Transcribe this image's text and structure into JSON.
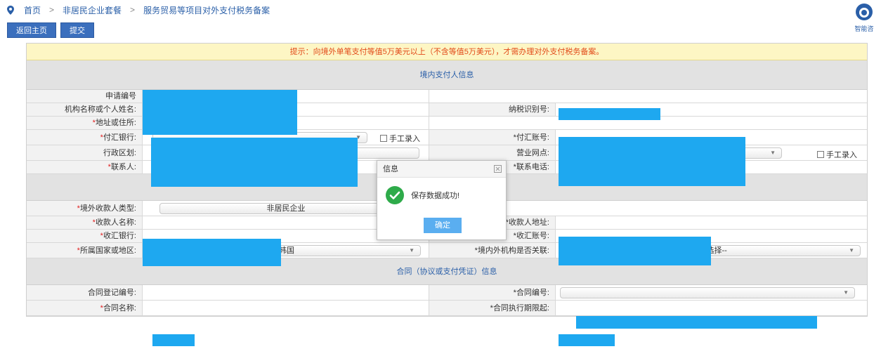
{
  "breadcrumb": {
    "home": "首页",
    "sep": ">",
    "level2": "非居民企业套餐",
    "level3": "服务贸易等项目对外支付税务备案"
  },
  "assistant": {
    "label": "智能咨"
  },
  "toolbar": {
    "back_label": "返回主页",
    "submit_label": "提交"
  },
  "tip": "提示：向境外单笔支付等值5万美元以上（不含等值5万美元），才需办理对外支付税务备案。",
  "sections": {
    "payer": "境内支付人信息",
    "payee": "",
    "contract": "合同（协议或支付凭证）信息"
  },
  "fields": {
    "apply_no": "申请编号",
    "org_name": "机构名称或个人姓名:",
    "tax_id": "纳税识别号:",
    "address": "地址或住所:",
    "remit_bank": "付汇银行:",
    "manual1": "手工录入",
    "remit_account": "付汇账号:",
    "region": "行政区划:",
    "business_outlet": "营业网点:",
    "manual2": "手工录入",
    "contact": "联系人:",
    "contact_phone": "联系电话:",
    "payee_type": "境外收款人类型:",
    "payee_type_value": "非居民企业",
    "payee_name": "收款人名称:",
    "payee_address": "收款人地址:",
    "recv_bank": "收汇银行:",
    "recv_account": "收汇账号:",
    "country": "所属国家或地区:",
    "country_value": "韩国",
    "related": "境内外机构是否关联:",
    "related_value": "--请选择--",
    "contract_reg_no": "合同登记编号:",
    "contract_no": "合同编号:",
    "contract_name": "合同名称:",
    "contract_start": "合同执行期限起:"
  },
  "required_mark": "*",
  "dialog": {
    "title": "信息",
    "message": "保存数据成功!",
    "ok_label": "确定"
  },
  "colors": {
    "redaction": "#1ea8f0",
    "primary_button": "#3b6fbd",
    "tip_text": "#e24b1a",
    "success": "#2eab4a"
  }
}
